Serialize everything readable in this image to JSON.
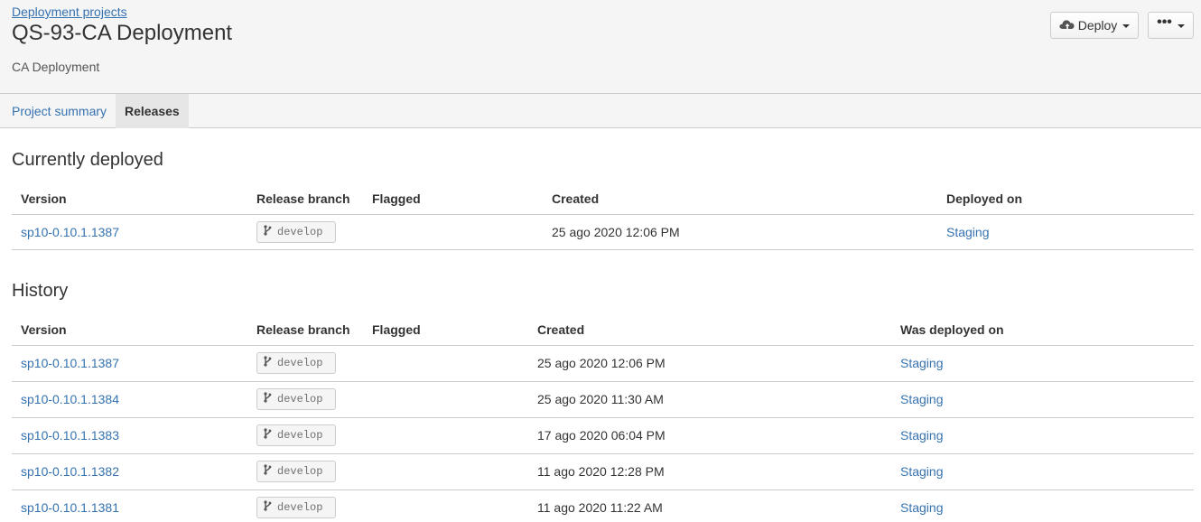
{
  "header": {
    "breadcrumb": "Deployment projects",
    "title": "QS-93-CA Deployment",
    "description": "CA Deployment",
    "deploy_label": "Deploy",
    "more_label": "•••"
  },
  "tabs": [
    {
      "label": "Project summary",
      "active": false
    },
    {
      "label": "Releases",
      "active": true
    }
  ],
  "current": {
    "title": "Currently deployed",
    "columns": [
      "Version",
      "Release branch",
      "Flagged",
      "Created",
      "Deployed on"
    ],
    "rows": [
      {
        "version": "sp10-0.10.1.1387",
        "branch": "develop",
        "flagged": "",
        "created": "25 ago 2020 12:06 PM",
        "env": "Staging"
      }
    ]
  },
  "history": {
    "title": "History",
    "columns": [
      "Version",
      "Release branch",
      "Flagged",
      "Created",
      "Was deployed on"
    ],
    "rows": [
      {
        "version": "sp10-0.10.1.1387",
        "branch": "develop",
        "flagged": "",
        "created": "25 ago 2020 12:06 PM",
        "env": "Staging"
      },
      {
        "version": "sp10-0.10.1.1384",
        "branch": "develop",
        "flagged": "",
        "created": "25 ago 2020 11:30 AM",
        "env": "Staging"
      },
      {
        "version": "sp10-0.10.1.1383",
        "branch": "develop",
        "flagged": "",
        "created": "17 ago 2020 06:04 PM",
        "env": "Staging"
      },
      {
        "version": "sp10-0.10.1.1382",
        "branch": "develop",
        "flagged": "",
        "created": "11 ago 2020 12:28 PM",
        "env": "Staging"
      },
      {
        "version": "sp10-0.10.1.1381",
        "branch": "develop",
        "flagged": "",
        "created": "11 ago 2020 11:22 AM",
        "env": "Staging"
      }
    ]
  }
}
